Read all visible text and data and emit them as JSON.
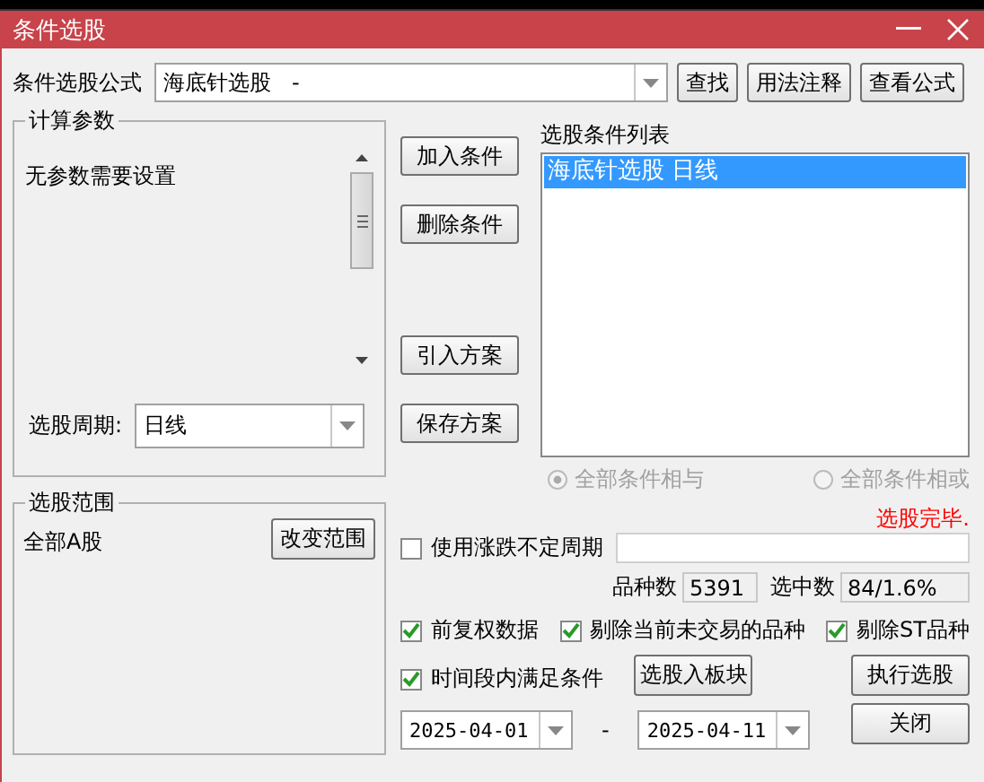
{
  "title_bar": {
    "title": "条件选股"
  },
  "formula": {
    "label": "条件选股公式",
    "value": "海底针选股   -",
    "buttons": [
      "查找",
      "用法注释",
      "查看公式"
    ]
  },
  "params_group": {
    "title": "计算参数",
    "message": "无参数需要设置",
    "period_label": "选股周期:",
    "period_value": "日线"
  },
  "action_buttons": [
    "加入条件",
    "删除条件",
    "引入方案",
    "保存方案"
  ],
  "condition_list": {
    "label": "选股条件列表",
    "items": [
      {
        "text": "海底针选股  日线",
        "selected": true
      }
    ]
  },
  "logic_options": [
    {
      "label": "全部条件相与",
      "selected": true,
      "disabled": true
    },
    {
      "label": "全部条件相或",
      "selected": false,
      "disabled": true
    }
  ],
  "scope_group": {
    "title": "选股范围",
    "scope": "全部A股",
    "button": "改变范围"
  },
  "status": "选股完毕.",
  "variable_period": {
    "label": "使用涨跌不定周期",
    "checked": false
  },
  "stats": [
    {
      "label": "品种数",
      "value": "5391"
    },
    {
      "label": "选中数",
      "value": "84/1.6%"
    }
  ],
  "options": [
    {
      "label": "前复权数据",
      "checked": true
    },
    {
      "label": "剔除当前未交易的品种",
      "checked": true
    },
    {
      "label": "剔除ST品种",
      "checked": true
    }
  ],
  "time_range": {
    "label": "时间段内满足条件",
    "checked": true,
    "start": "2025-04-01",
    "separator": "-",
    "end": "2025-04-11"
  },
  "buttons": [
    "选股入板块",
    "执行选股",
    "关闭"
  ]
}
